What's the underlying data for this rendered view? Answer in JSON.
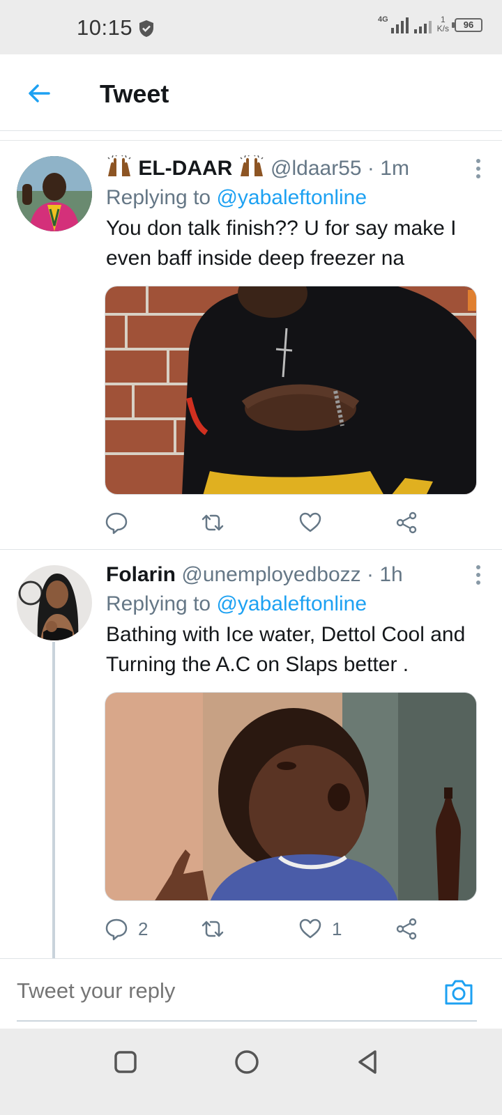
{
  "status_bar": {
    "time": "10:15",
    "network": "4G",
    "speed_value": "1",
    "speed_unit": "K/s",
    "battery": "96"
  },
  "header": {
    "back_icon": "arrow-left-icon",
    "title": "Tweet"
  },
  "tweets": [
    {
      "display_name": "EL-DAAR",
      "name_emoji": "raising-hands-emoji",
      "handle": "@ldaar55",
      "time": "1m",
      "replying_prefix": "Replying to",
      "replying_to": "@yabaleftonline",
      "text": "You don talk finish?? U for say make I even baff inside deep freezer na",
      "media_desc": "photo",
      "reply_count": "",
      "retweet_count": "",
      "like_count": ""
    },
    {
      "display_name": "Folarin",
      "handle": "@unemployedbozz",
      "time": "1h",
      "replying_prefix": "Replying to",
      "replying_to": "@yabaleftonline",
      "text": "Bathing with Ice water, Dettol Cool and Turning the A.C on Slaps better .",
      "media_desc": "photo",
      "reply_count": "2",
      "retweet_count": "",
      "like_count": "1"
    }
  ],
  "reply_bar": {
    "placeholder": "Tweet your reply",
    "camera_icon": "camera-icon"
  },
  "colors": {
    "accent": "#1da1f2",
    "secondary_text": "#657786",
    "primary_text": "#14171a"
  }
}
